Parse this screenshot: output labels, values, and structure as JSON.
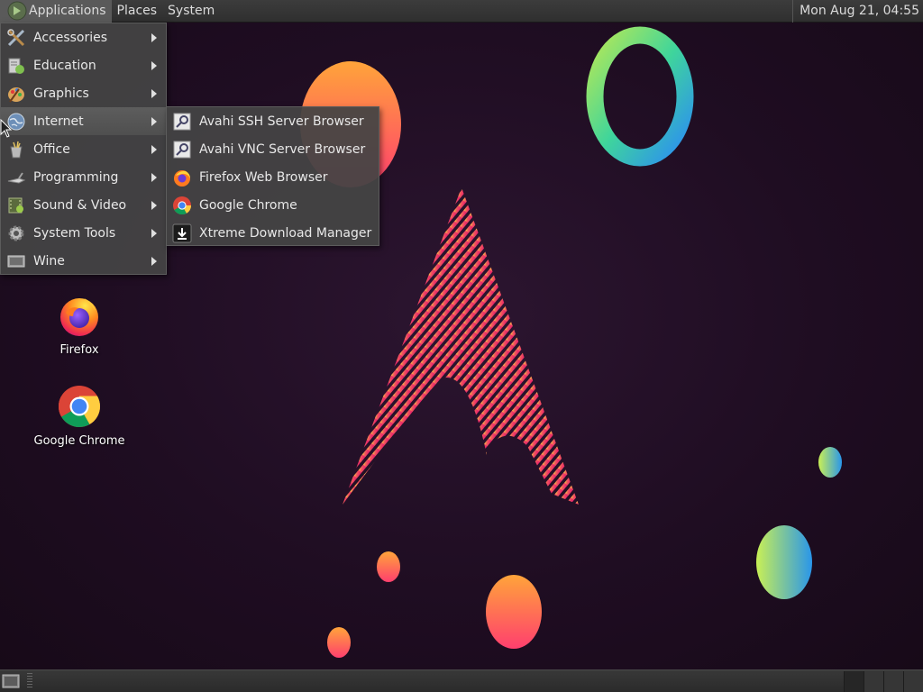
{
  "top_panel": {
    "menus": [
      {
        "label": "Applications"
      },
      {
        "label": "Places"
      },
      {
        "label": "System"
      }
    ],
    "clock": "Mon Aug 21, 04:55"
  },
  "applications_menu": {
    "items": [
      {
        "label": "Accessories",
        "icon": "accessories-icon"
      },
      {
        "label": "Education",
        "icon": "education-icon"
      },
      {
        "label": "Graphics",
        "icon": "graphics-icon"
      },
      {
        "label": "Internet",
        "icon": "internet-globe-icon"
      },
      {
        "label": "Office",
        "icon": "office-icon"
      },
      {
        "label": "Programming",
        "icon": "programming-icon"
      },
      {
        "label": "Sound & Video",
        "icon": "sound-video-icon"
      },
      {
        "label": "System Tools",
        "icon": "gear-icon"
      },
      {
        "label": "Wine",
        "icon": "wine-icon"
      }
    ],
    "open_submenu": "Internet"
  },
  "internet_submenu": {
    "items": [
      {
        "label": "Avahi SSH Server Browser",
        "icon": "avahi-icon"
      },
      {
        "label": "Avahi VNC Server Browser",
        "icon": "avahi-icon"
      },
      {
        "label": "Firefox Web Browser",
        "icon": "firefox-icon"
      },
      {
        "label": "Google Chrome",
        "icon": "chrome-icon"
      },
      {
        "label": "Xtreme Download Manager",
        "icon": "download-icon"
      }
    ]
  },
  "desktop_icons": [
    {
      "label": "Firefox",
      "icon": "firefox-icon"
    },
    {
      "label": "Google Chrome",
      "icon": "chrome-icon"
    }
  ],
  "colors": {
    "panel": "#333333",
    "menu_bg": "#444444",
    "wallpaper": "#1f0d22",
    "arch_logo_pink": "#e8256f",
    "arch_logo_yellow": "#f6c744"
  }
}
